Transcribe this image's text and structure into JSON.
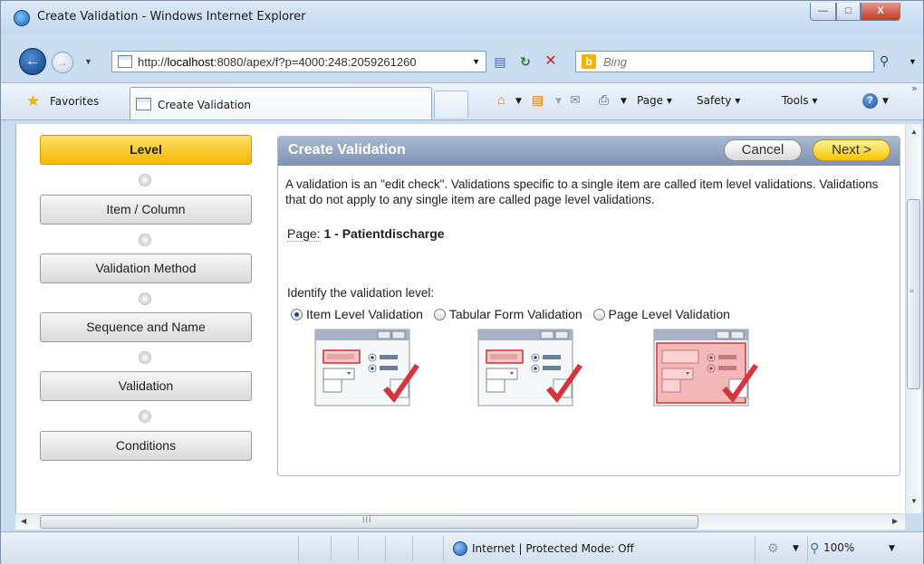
{
  "window": {
    "title": "Create Validation - Windows Internet Explorer",
    "min_icon": "minimize-icon",
    "max_icon": "maximize-icon",
    "close_label": "X"
  },
  "address_bar": {
    "url_prefix": "http://",
    "url_host": "localhost",
    "url_rest": ":8080/apex/f?p=4000:248:2059261260"
  },
  "search": {
    "engine": "Bing",
    "placeholder": "Bing"
  },
  "favorites_bar": {
    "favorites_label": "Favorites",
    "tab_label": "Create Validation",
    "commands": {
      "page": "Page",
      "safety": "Safety",
      "tools": "Tools"
    },
    "chevron": "»"
  },
  "wizard": {
    "steps": [
      {
        "label": "Level",
        "active": true
      },
      {
        "label": "Item / Column",
        "active": false
      },
      {
        "label": "Validation Method",
        "active": false
      },
      {
        "label": "Sequence and Name",
        "active": false
      },
      {
        "label": "Validation",
        "active": false
      },
      {
        "label": "Conditions",
        "active": false
      }
    ]
  },
  "region": {
    "title": "Create Validation",
    "cancel_label": "Cancel",
    "next_label": "Next >",
    "intro": "A validation is an \"edit check\". Validations specific to a single item are called item level validations. Validations that do not apply to any single item are called page level validations.",
    "page_label": "Page:",
    "page_value": "1 - Patientdischarge",
    "identify_label": "Identify the validation level:",
    "options": [
      {
        "label": "Item Level Validation",
        "checked": true
      },
      {
        "label": "Tabular Form Validation",
        "checked": false
      },
      {
        "label": "Page Level Validation",
        "checked": false
      }
    ]
  },
  "scrollbar": {
    "grip": "≡",
    "h_grip": "III"
  },
  "status_bar": {
    "zone": "Internet | Protected Mode: Off",
    "zoom": "100%"
  },
  "colors": {
    "accent_yellow": "#f6b700",
    "region_header": "#7e93b3",
    "checkmark_red": "#d8343c"
  }
}
